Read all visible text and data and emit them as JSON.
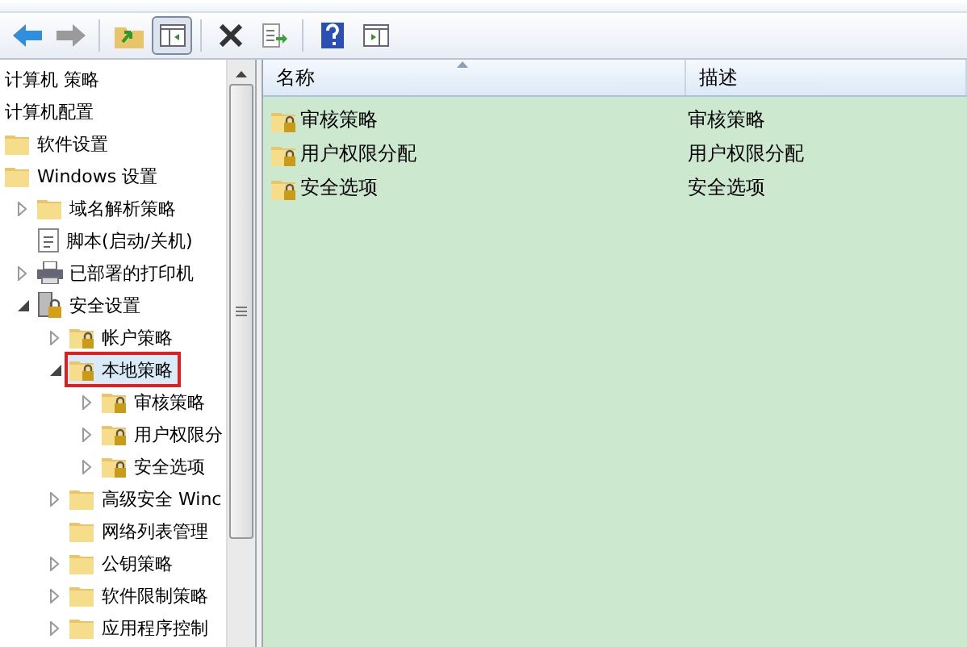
{
  "toolbar": [
    {
      "kind": "back",
      "pressed": false
    },
    {
      "kind": "forward",
      "pressed": false
    },
    {
      "kind": "sep"
    },
    {
      "kind": "up",
      "pressed": false
    },
    {
      "kind": "tree",
      "pressed": true
    },
    {
      "kind": "sep"
    },
    {
      "kind": "delete",
      "pressed": false
    },
    {
      "kind": "export",
      "pressed": false
    },
    {
      "kind": "sep"
    },
    {
      "kind": "help",
      "pressed": false
    },
    {
      "kind": "view",
      "pressed": false
    }
  ],
  "tree": [
    {
      "label": "计算机 策略",
      "selected": false,
      "children": [
        {
          "label": "计算机配置",
          "selected": false,
          "children": [
            {
              "label": "软件设置",
              "kind": "folder",
              "selected": false
            },
            {
              "label": "Windows 设置",
              "kind": "folder",
              "selected": false,
              "children": [
                {
                  "label": "域名解析策略",
                  "kind": "folder",
                  "expanded": false,
                  "selected": false
                },
                {
                  "label": "脚本(启动/关机)",
                  "kind": "script",
                  "selected": false
                },
                {
                  "label": "已部署的打印机",
                  "kind": "printer",
                  "expanded": false,
                  "selected": false
                },
                {
                  "label": "安全设置",
                  "kind": "security",
                  "expanded": true,
                  "selected": false,
                  "children": [
                    {
                      "label": "帐户策略",
                      "kind": "lock-folder",
                      "expanded": false,
                      "selected": false
                    },
                    {
                      "label": "本地策略",
                      "kind": "lock-folder",
                      "expanded": true,
                      "selected": true,
                      "children": [
                        {
                          "label": "审核策略",
                          "kind": "lock-folder",
                          "expanded": false,
                          "selected": false
                        },
                        {
                          "label": "用户权限分",
                          "kind": "lock-folder",
                          "expanded": false,
                          "selected": false
                        },
                        {
                          "label": "安全选项",
                          "kind": "lock-folder",
                          "expanded": false,
                          "selected": false
                        }
                      ]
                    },
                    {
                      "label": "高级安全 Winc",
                      "kind": "folder",
                      "expanded": false,
                      "selected": false
                    },
                    {
                      "label": "网络列表管理",
                      "kind": "folder",
                      "selected": false
                    },
                    {
                      "label": "公钥策略",
                      "kind": "folder",
                      "expanded": false,
                      "selected": false
                    },
                    {
                      "label": "软件限制策略",
                      "kind": "folder",
                      "expanded": false,
                      "selected": false
                    },
                    {
                      "label": "应用程序控制",
                      "kind": "folder",
                      "expanded": false,
                      "selected": false
                    }
                  ]
                }
              ]
            }
          ]
        }
      ]
    }
  ],
  "table": {
    "columns": [
      "名称",
      "描述"
    ],
    "rows": [
      {
        "name": "审核策略",
        "description": "审核策略"
      },
      {
        "name": "用户权限分配",
        "description": "用户权限分配"
      },
      {
        "name": "安全选项",
        "description": "安全选项"
      }
    ]
  }
}
